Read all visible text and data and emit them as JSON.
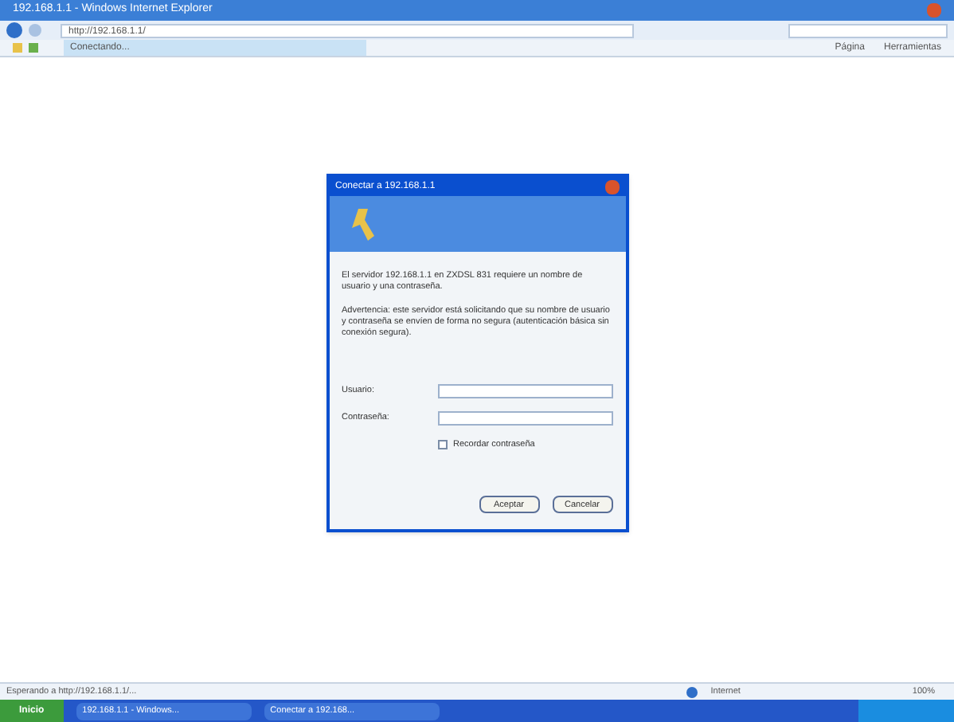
{
  "window": {
    "title": "192.168.1.1 - Windows Internet Explorer"
  },
  "address_bar": {
    "value": "http://192.168.1.1/"
  },
  "tab": {
    "label": "Conectando..."
  },
  "toolbar": [
    "Página",
    "Herramientas"
  ],
  "dialog": {
    "title": "Conectar a 192.168.1.1",
    "message": "El servidor 192.168.1.1 en ZXDSL 831 requiere un nombre de usuario y una contraseña.",
    "warning": "Advertencia: este servidor está solicitando que su nombre de usuario y contraseña se envíen de forma no segura (autenticación básica sin conexión segura).",
    "user_label": "Usuario:",
    "password_label": "Contraseña:",
    "remember": {
      "label": "Recordar contraseña",
      "checked": false
    },
    "buttons": [
      "Aceptar",
      "Cancelar"
    ]
  },
  "status_bar": {
    "text": "Esperando a http://192.168.1.1/...",
    "zone": "Internet",
    "zoom": "100%"
  },
  "taskbar": {
    "start": "Inicio",
    "tasks": [
      "192.168.1.1 - Windows...",
      "Conectar a 192.168..."
    ]
  }
}
